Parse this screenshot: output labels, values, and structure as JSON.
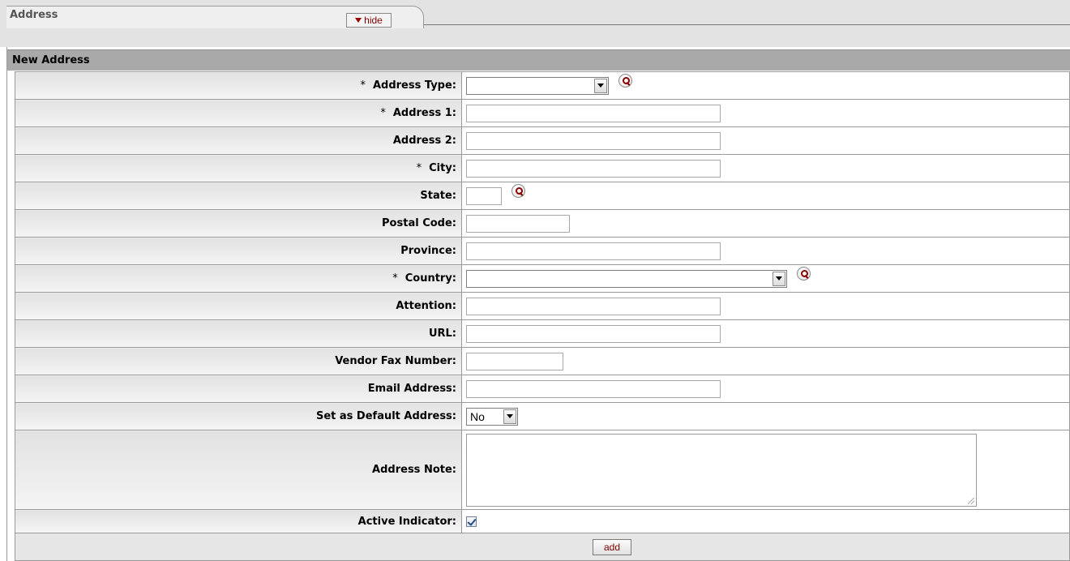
{
  "tab": {
    "title": "Address",
    "hide_label": "hide"
  },
  "section": {
    "title": "New Address"
  },
  "fields": {
    "address_type": {
      "label": "Address Type:",
      "required": "*",
      "value": ""
    },
    "address_1": {
      "label": "Address 1:",
      "required": "*",
      "value": ""
    },
    "address_2": {
      "label": "Address 2:",
      "value": ""
    },
    "city": {
      "label": "City:",
      "required": "*",
      "value": ""
    },
    "state": {
      "label": "State:",
      "value": ""
    },
    "postal_code": {
      "label": "Postal Code:",
      "value": ""
    },
    "province": {
      "label": "Province:",
      "value": ""
    },
    "country": {
      "label": "Country:",
      "required": "*",
      "value": ""
    },
    "attention": {
      "label": "Attention:",
      "value": ""
    },
    "url": {
      "label": "URL:",
      "value": ""
    },
    "vendor_fax": {
      "label": "Vendor Fax Number:",
      "value": ""
    },
    "email": {
      "label": "Email Address:",
      "value": ""
    },
    "default_address": {
      "label": "Set as Default Address:",
      "value": "No"
    },
    "address_note": {
      "label": "Address Note:",
      "value": ""
    },
    "active_indicator": {
      "label": "Active Indicator:",
      "checked": true
    }
  },
  "actions": {
    "add_label": "add"
  },
  "icons": {
    "lookup": "magnifier-lookup-icon",
    "dropdown": "chevron-down-icon",
    "collapse": "triangle-down-icon"
  },
  "colors": {
    "header_bg": "#a9a9a9",
    "label_bg": "#e8e8e8",
    "button_text": "#800000"
  }
}
